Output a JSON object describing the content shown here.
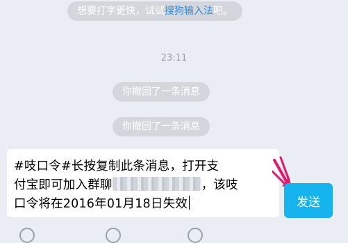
{
  "tip": {
    "prefix": "想要打字更快，试试",
    "link": "搜狗输入法",
    "suffix": "吧。"
  },
  "chat": {
    "time": "23:11",
    "recall_1": "你撤回了一条消息",
    "recall_2": "你撤回了一条消息"
  },
  "composer": {
    "line1": "#吱口令#长按复制此条消息，打开支",
    "line2_start": "付宝即可加入群聊",
    "line2_end": "，该吱",
    "line3": "口令将在2016年01月18日失效"
  },
  "send_button": {
    "label": "发送"
  },
  "icons": [
    "voice-icon",
    "emoji-icon",
    "plus-icon"
  ],
  "colors": {
    "accent": "#15b4ef",
    "arrow": "#e5176b",
    "link": "#2f8be0"
  }
}
